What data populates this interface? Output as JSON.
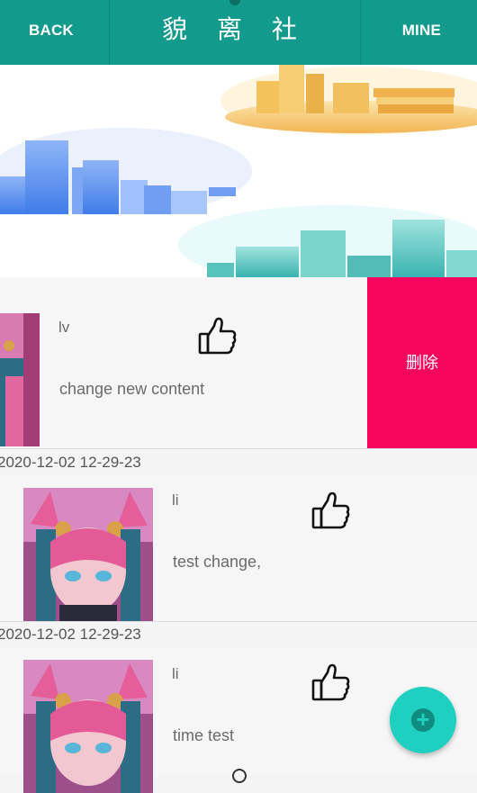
{
  "header": {
    "back": "BACK",
    "title": "貌 离 社",
    "mine": "MINE"
  },
  "posts": [
    {
      "user": "lv",
      "content": "change new content",
      "action": "删除"
    },
    {
      "date": "2020-12-02 12-29-23",
      "user": "li",
      "content": "test change,"
    },
    {
      "date": "2020-12-02 12-29-23",
      "user": "li",
      "content": "time test"
    }
  ],
  "colors": {
    "header_bg": "#129a8c",
    "delete_bg": "#f5055e",
    "fab_bg": "#1fcfc0"
  },
  "icons": {
    "like": "thumbs-up-icon",
    "fab": "plus-icon"
  }
}
